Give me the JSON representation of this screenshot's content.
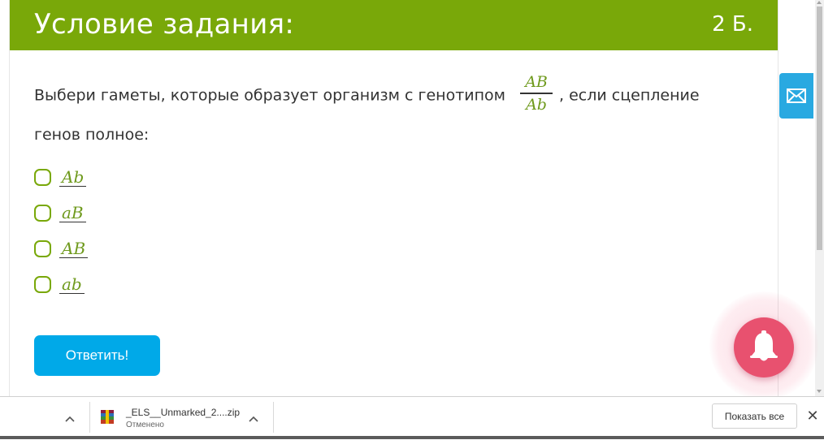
{
  "card": {
    "title": "Условие задания:",
    "points": "2 Б.",
    "question_part1": "Выбери гаметы, которые образует организм с генотипом",
    "genotype_numerator": "AB",
    "genotype_denominator": "Ab",
    "question_part2": ", если сцепление генов полное:",
    "options": [
      {
        "label": "Ab",
        "checked": false
      },
      {
        "label": "aB",
        "checked": false
      },
      {
        "label": "AB",
        "checked": false
      },
      {
        "label": "ab",
        "checked": false
      }
    ],
    "submit_label": "Ответить!"
  },
  "colors": {
    "header_green": "#79a809",
    "accent_blue": "#00a9e8",
    "bell_pink": "#e8516f",
    "mail_blue": "#29a9e1"
  },
  "side_buttons": {
    "mail_icon": "envelope-icon",
    "bell_icon": "bell-icon"
  },
  "download_bar": {
    "file_name": "_ELS__Unmarked_2....zip",
    "file_status": "Отменено",
    "show_all_label": "Показать все",
    "close_label": "✕"
  }
}
